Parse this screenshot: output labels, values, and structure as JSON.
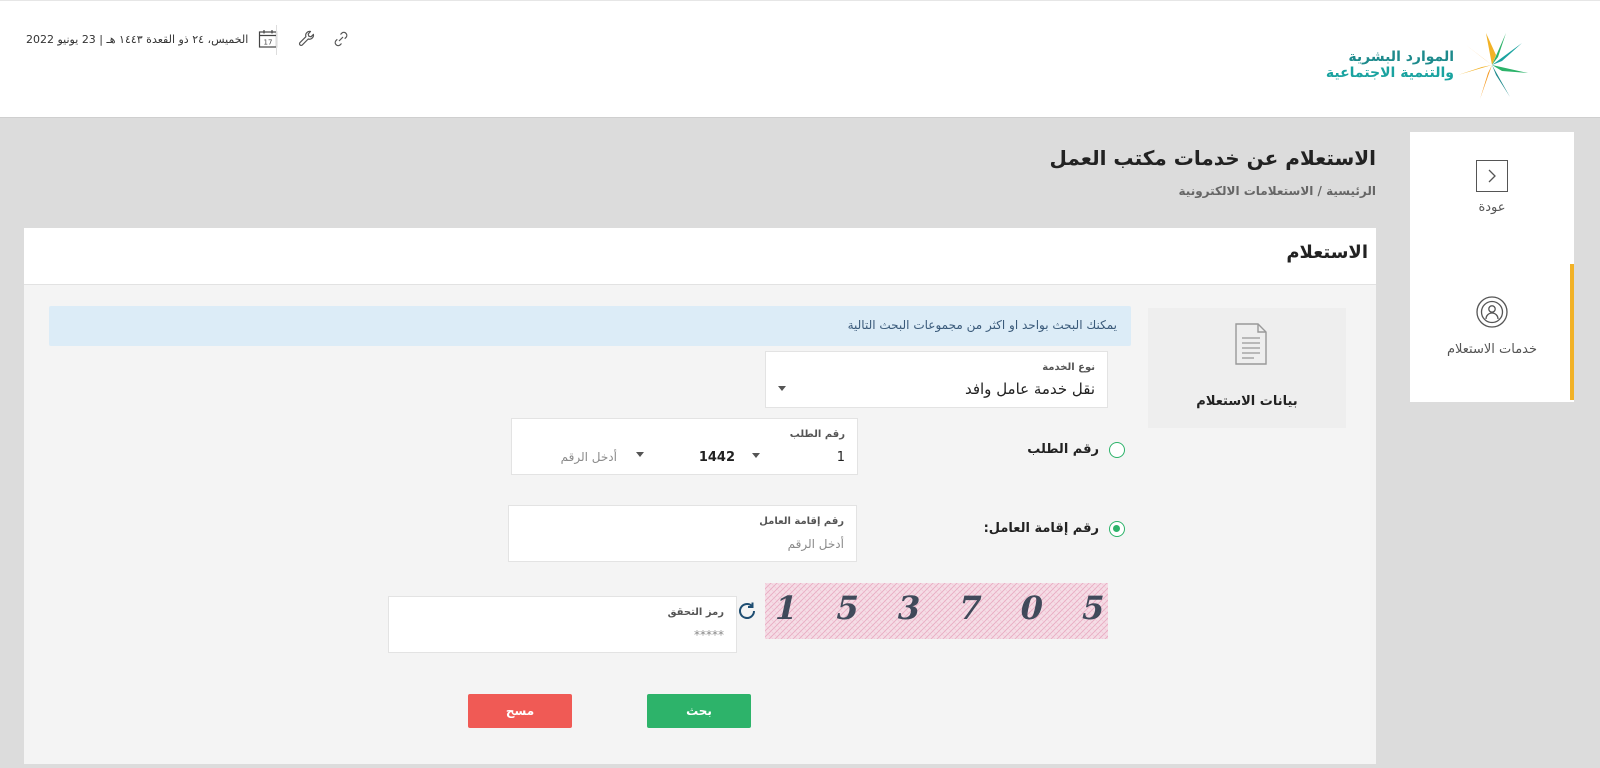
{
  "header": {
    "date_text": "الخميس، ٢٤ ذو القعدة ١٤٤٣ هـ | 23 يونيو 2022",
    "calendar_day": "17",
    "logo": {
      "line1": "الموارد البشرية",
      "line2": "والتنمية الاجتماعية"
    }
  },
  "nav": {
    "back_label": "عودة",
    "services_label": "خدمات الاستعلام"
  },
  "page": {
    "title": "الاستعلام عن خدمات مكتب العمل",
    "breadcrumb": "الرئيسية / الاستعلامات الالكترونية"
  },
  "card": {
    "title": "الاستعلام",
    "side_label": "بيانات الاستعلام",
    "info": "يمكنك البحث بواحد او اكثر من مجموعات البحث التالية"
  },
  "form": {
    "service_type": {
      "label": "نوع الخدمة",
      "value": "نقل خدمة عامل وافد"
    },
    "request_option": {
      "label": "رقم الطلب",
      "selected": false
    },
    "request_field": {
      "label": "رقم الطلب",
      "first": "1",
      "year": "1442",
      "placeholder": "أدخل الرقم"
    },
    "iqama_option": {
      "label": "رقم إقامة العامل:",
      "selected": true
    },
    "iqama_field": {
      "label": "رقم إقامة العامل",
      "placeholder": "أدخل الرقم"
    },
    "captcha_field": {
      "label": "رمز التحقق",
      "placeholder": "*****"
    },
    "captcha_text": "1 5 3 7 0 5"
  },
  "buttons": {
    "search": "بحث",
    "clear": "مسح"
  },
  "colors": {
    "primary_green": "#2db36a",
    "danger_red": "#f05a55",
    "accent_yellow": "#f2b227",
    "info_bg": "#dcecf7"
  }
}
